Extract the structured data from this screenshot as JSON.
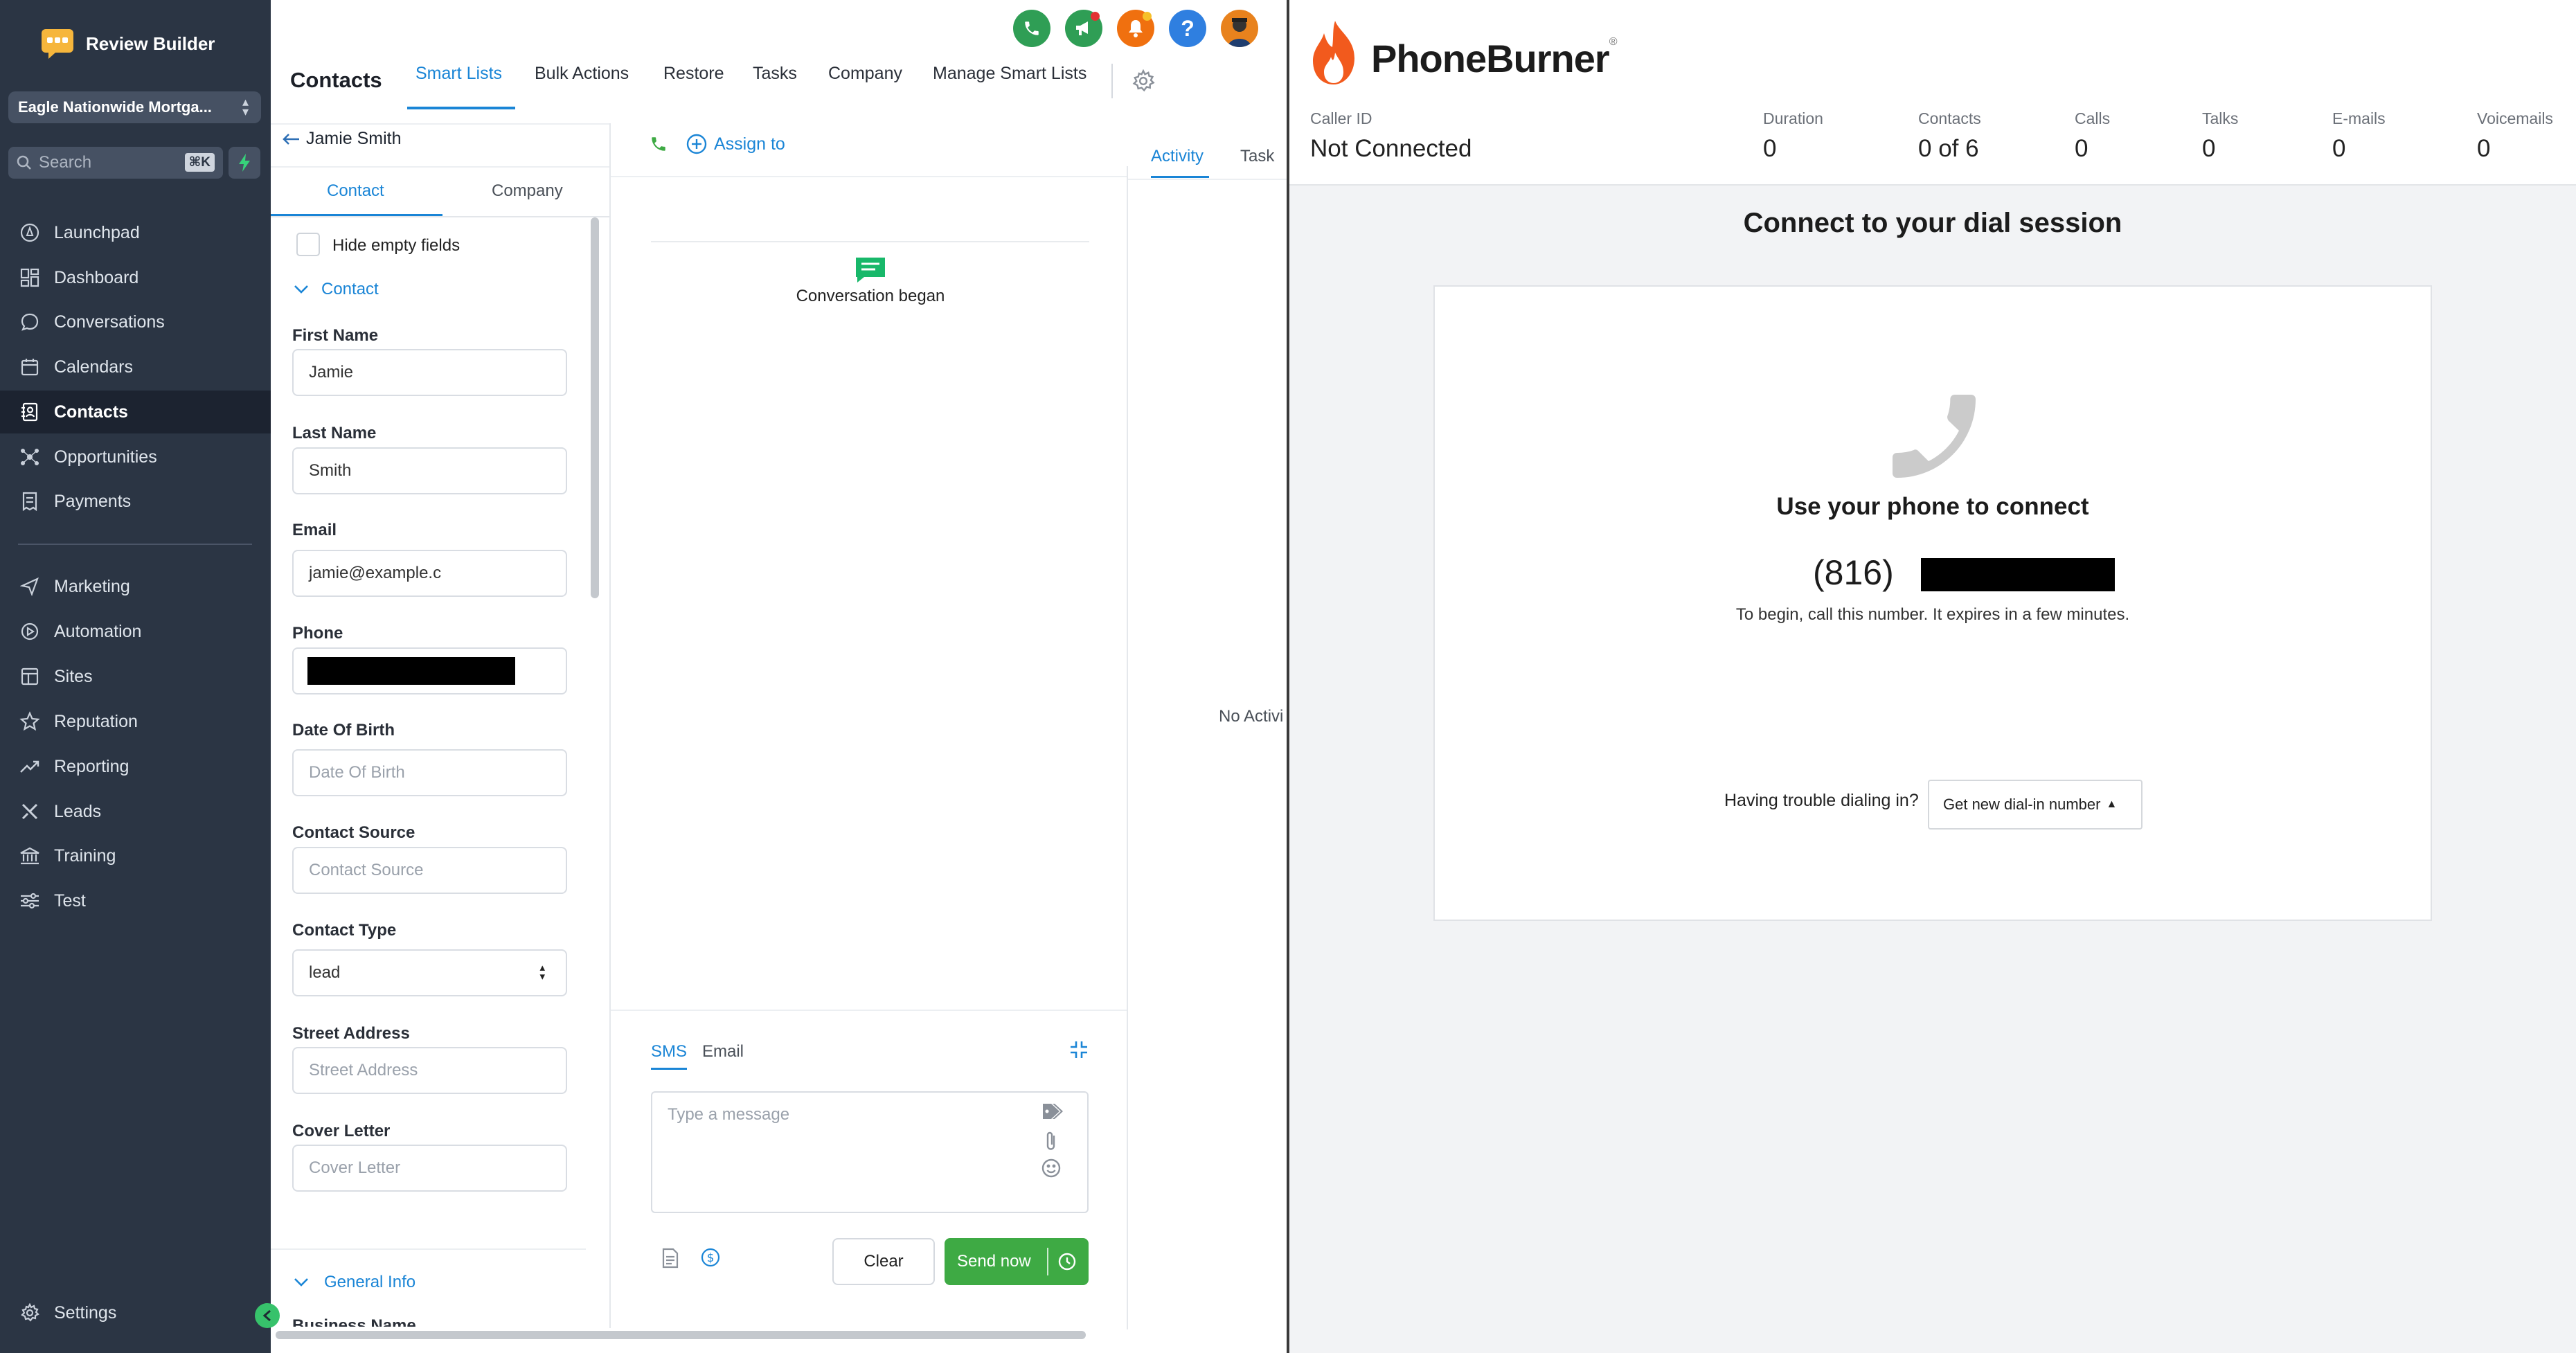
{
  "app": {
    "brand": "Review Builder",
    "account": "Eagle Nationwide Mortga...",
    "search_placeholder": "Search",
    "search_shortcut": "⌘K",
    "nav": [
      "Launchpad",
      "Dashboard",
      "Conversations",
      "Calendars",
      "Contacts",
      "Opportunities",
      "Payments"
    ],
    "nav2": [
      "Marketing",
      "Automation",
      "Sites",
      "Reputation",
      "Reporting",
      "Leads",
      "Training",
      "Test"
    ],
    "settings": "Settings",
    "page_title": "Contacts",
    "tabs": [
      "Smart Lists",
      "Bulk Actions",
      "Restore",
      "Tasks",
      "Company",
      "Manage Smart Lists"
    ],
    "back_name": "Jamie Smith",
    "sub_tabs": [
      "Contact",
      "Company"
    ],
    "hide_empty": "Hide empty fields",
    "section_contact": "Contact",
    "fields": {
      "first_name_label": "First Name",
      "first_name": "Jamie",
      "last_name_label": "Last Name",
      "last_name": "Smith",
      "email_label": "Email",
      "email": "jamie@example.c",
      "phone_label": "Phone",
      "dob_label": "Date Of Birth",
      "dob_placeholder": "Date Of Birth",
      "source_label": "Contact Source",
      "source_placeholder": "Contact Source",
      "type_label": "Contact Type",
      "type_value": "lead",
      "street_label": "Street Address",
      "street_placeholder": "Street Address",
      "cover_label": "Cover Letter",
      "cover_placeholder": "Cover Letter"
    },
    "section_general": "General Info",
    "business_name": "Business Name",
    "assign_to": "Assign to",
    "conversation_began": "Conversation began",
    "compose_tabs": [
      "SMS",
      "Email"
    ],
    "message_placeholder": "Type a message",
    "clear": "Clear",
    "send_now": "Send now",
    "activity_tabs": [
      "Activity",
      "Task"
    ],
    "no_activity": "No Activi"
  },
  "phoneburner": {
    "logo": "PhoneBurner",
    "stats": [
      {
        "label": "Caller ID",
        "value": "Not Connected"
      },
      {
        "label": "Duration",
        "value": "0"
      },
      {
        "label": "Contacts",
        "value": "0 of 6"
      },
      {
        "label": "Calls",
        "value": "0"
      },
      {
        "label": "Talks",
        "value": "0"
      },
      {
        "label": "E-mails",
        "value": "0"
      },
      {
        "label": "Voicemails",
        "value": "0"
      }
    ],
    "heading": "Connect to your dial session",
    "use_phone": "Use your phone to connect",
    "area_code": "(816)",
    "instructions": "To begin, call this number. It expires in a few minutes.",
    "trouble": "Having trouble dialing in?",
    "new_number": "Get new dial-in number"
  },
  "colors": {
    "sidebar": "#2b3544",
    "accent": "#1a85d6",
    "green": "#3eaa44",
    "pb_orange": "#f25a1d"
  }
}
